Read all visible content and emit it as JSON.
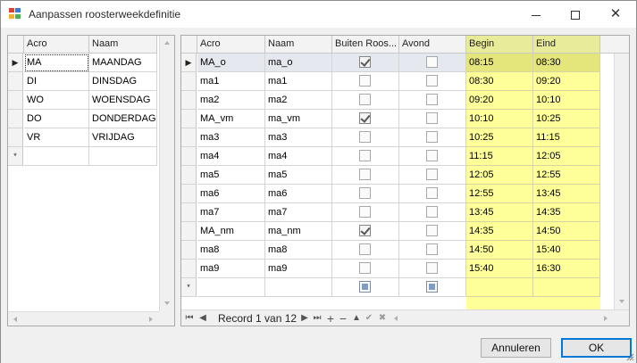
{
  "window": {
    "title": "Aanpassen roosterweekdefinitie",
    "min_icon": "minimize-icon",
    "max_icon": "maximize-icon",
    "close_icon": "close-icon"
  },
  "days_grid": {
    "columns": [
      "Acro",
      "Naam"
    ],
    "rows": [
      {
        "acro": "MA",
        "naam": "MAANDAG",
        "selected": true
      },
      {
        "acro": "DI",
        "naam": "DINSDAG"
      },
      {
        "acro": "WO",
        "naam": "WOENSDAG"
      },
      {
        "acro": "DO",
        "naam": "DONDERDAG"
      },
      {
        "acro": "VR",
        "naam": "VRIJDAG"
      }
    ],
    "new_row_marker": "*",
    "current_row_marker": "▶"
  },
  "hours_grid": {
    "columns": [
      "Acro",
      "Naam",
      "Buiten Roos...",
      "Avond",
      "Begin",
      "Eind"
    ],
    "rows": [
      {
        "acro": "MA_o",
        "naam": "ma_o",
        "buiten": true,
        "avond": false,
        "begin": "08:15",
        "eind": "08:30",
        "selected": true
      },
      {
        "acro": "ma1",
        "naam": "ma1",
        "buiten": false,
        "avond": false,
        "begin": "08:30",
        "eind": "09:20"
      },
      {
        "acro": "ma2",
        "naam": "ma2",
        "buiten": false,
        "avond": false,
        "begin": "09:20",
        "eind": "10:10"
      },
      {
        "acro": "MA_vm",
        "naam": "ma_vm",
        "buiten": true,
        "avond": false,
        "begin": "10:10",
        "eind": "10:25"
      },
      {
        "acro": "ma3",
        "naam": "ma3",
        "buiten": false,
        "avond": false,
        "begin": "10:25",
        "eind": "11:15"
      },
      {
        "acro": "ma4",
        "naam": "ma4",
        "buiten": false,
        "avond": false,
        "begin": "11:15",
        "eind": "12:05"
      },
      {
        "acro": "ma5",
        "naam": "ma5",
        "buiten": false,
        "avond": false,
        "begin": "12:05",
        "eind": "12:55"
      },
      {
        "acro": "ma6",
        "naam": "ma6",
        "buiten": false,
        "avond": false,
        "begin": "12:55",
        "eind": "13:45"
      },
      {
        "acro": "ma7",
        "naam": "ma7",
        "buiten": false,
        "avond": false,
        "begin": "13:45",
        "eind": "14:35"
      },
      {
        "acro": "MA_nm",
        "naam": "ma_nm",
        "buiten": true,
        "avond": false,
        "begin": "14:35",
        "eind": "14:50"
      },
      {
        "acro": "ma8",
        "naam": "ma8",
        "buiten": false,
        "avond": false,
        "begin": "14:50",
        "eind": "15:40"
      },
      {
        "acro": "ma9",
        "naam": "ma9",
        "buiten": false,
        "avond": false,
        "begin": "15:40",
        "eind": "16:30"
      }
    ],
    "new_row_marker": "*",
    "current_row_marker": "▶"
  },
  "navigator": {
    "record_text": "Record 1 van 12",
    "icons": [
      "first-record-icon",
      "prev-record-icon",
      "next-record-icon",
      "last-record-icon",
      "append-icon",
      "delete-icon",
      "edit-icon",
      "end-edit-icon",
      "cancel-edit-icon"
    ]
  },
  "buttons": {
    "cancel": "Annuleren",
    "ok": "OK"
  },
  "colors": {
    "highlight_column": "#ffff99",
    "highlight_header": "#e8eb97",
    "selected_row": "#e6e8ef",
    "default_button_border": "#0078d7"
  }
}
